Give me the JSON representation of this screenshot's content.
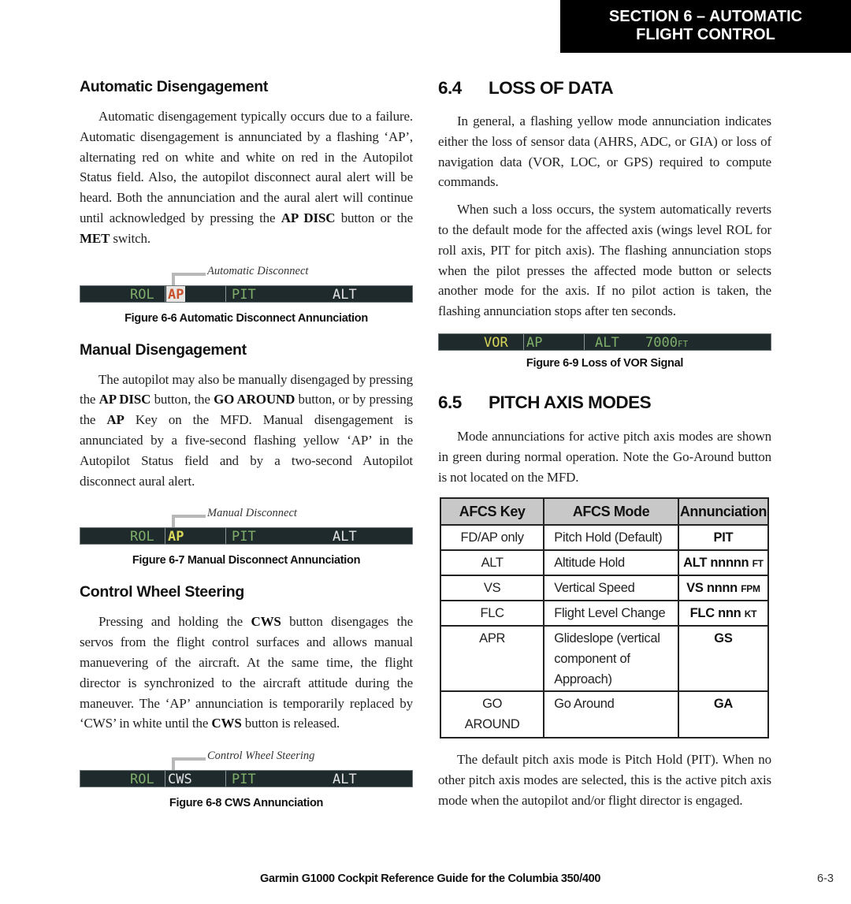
{
  "header": {
    "section_line1": "SECTION 6 – AUTOMATIC",
    "section_line2": "FLIGHT CONTROL"
  },
  "left": {
    "auto_disengage": {
      "heading": "Automatic Disengagement",
      "para_a": "Automatic disengagement typically occurs due to a failure.  Automatic disengagement is annunciated by a flashing ‘AP’, alternating red on white and white on red in the Autopilot Status field.  Also, the autopilot disconnect aural alert will be heard.  Both the annunciation and the aural alert will continue until acknowledged by pressing the ",
      "bold1": "AP DISC",
      "para_b": " button or the ",
      "bold2": "MET",
      "para_c": " switch."
    },
    "fig6": {
      "callout": "Automatic Disconnect",
      "roll": "ROL",
      "ap": "AP",
      "pitch": "PIT",
      "alt": "ALT",
      "caption": "Figure 6-6  Automatic Disconnect Annunciation"
    },
    "manual_disengage": {
      "heading": "Manual Disengagement",
      "p1": "The autopilot may also be manually disengaged by pressing the ",
      "b1": "AP DISC",
      "p2": " button, the ",
      "b2": "GO AROUND",
      "p3": " button, or by pressing the ",
      "b3": "AP",
      "p4": " Key on the MFD.  Manual disengagement is annunciated by a five-second flashing yellow ‘AP’ in the Autopilot Status field and by a two-second Autopilot disconnect aural alert."
    },
    "fig7": {
      "callout": "Manual Disconnect",
      "roll": "ROL",
      "ap": "AP",
      "pitch": "PIT",
      "alt": "ALT",
      "caption": "Figure 6-7  Manual Disconnect Annunciation"
    },
    "cws": {
      "heading": "Control Wheel Steering",
      "p1": "Pressing and holding the ",
      "b1": "CWS",
      "p2": " button disengages the servos from the flight control surfaces and allows manual manuevering of the aircraft.  At the same time, the flight director is synchronized to the aircraft attitude during the maneuver.  The ‘AP’ annunciation is temporarily replaced by ‘CWS’ in white until the ",
      "b2": "CWS",
      "p3": " button is released."
    },
    "fig8": {
      "callout": "Control Wheel Steering",
      "roll": "ROL",
      "ap": "CWS",
      "pitch": "PIT",
      "alt": "ALT",
      "caption": "Figure 6-8  CWS Annunciation"
    }
  },
  "right": {
    "loss_of_data": {
      "num": "6.4",
      "title": "LOSS OF DATA",
      "para1": "In general, a flashing yellow mode annunciation indicates either the loss of sensor data (AHRS, ADC, or GIA) or loss of navigation data (VOR, LOC, or GPS) required to compute commands.",
      "para2": "When such a loss occurs, the system automatically reverts to the default mode for the affected axis (wings level ROL for roll axis, PIT for pitch axis).  The flashing annunciation stops when the pilot presses the affected mode button or selects another mode for the axis.  If no pilot action is taken, the flashing annunciation stops after ten seconds."
    },
    "fig9": {
      "roll": "VOR",
      "ap": "AP",
      "pitch": "ALT",
      "alt_value": "7000",
      "alt_unit": "FT",
      "caption": "Figure 6-9  Loss of VOR Signal"
    },
    "pitch_modes": {
      "num": "6.5",
      "title": "PITCH AXIS MODES",
      "para1": "Mode annunciations for active pitch axis modes are shown in green during normal operation.  Note the Go-Around button is not located on the MFD.",
      "para2": "The default pitch axis mode is Pitch Hold (PIT).  When no other pitch axis modes are selected, this is the active pitch axis mode when the autopilot and/or flight director is engaged."
    },
    "table": {
      "headers": [
        "AFCS Key",
        "AFCS Mode",
        "Annunciation"
      ],
      "rows": [
        {
          "key": "FD/AP only",
          "mode": "Pitch Hold (Default)",
          "ann": "PIT",
          "unit": ""
        },
        {
          "key": "ALT",
          "mode": "Altitude Hold",
          "ann": "ALT nnnnn ",
          "unit": "FT"
        },
        {
          "key": "VS",
          "mode": "Vertical Speed",
          "ann": "VS nnnn ",
          "unit": "FPM"
        },
        {
          "key": "FLC",
          "mode": "Flight Level Change",
          "ann": "FLC nnn ",
          "unit": "KT"
        },
        {
          "key": "APR",
          "mode": "Glideslope (vertical component of Approach)",
          "ann": "GS",
          "unit": ""
        },
        {
          "key": "GO AROUND",
          "mode": "Go Around",
          "ann": "GA",
          "unit": ""
        }
      ]
    }
  },
  "footer": {
    "title": "Garmin G1000 Cockpit Reference Guide for the Columbia 350/400",
    "page": "6-3"
  },
  "colors": {
    "annunciation_green": "#7fae6a",
    "annunciation_white": "#e3e3e3",
    "annunciation_yellow": "#d8d65a",
    "annunciation_red": "#c8502a",
    "bar_background": "#1f2a2c",
    "table_header_bg": "#c8c8c8"
  }
}
